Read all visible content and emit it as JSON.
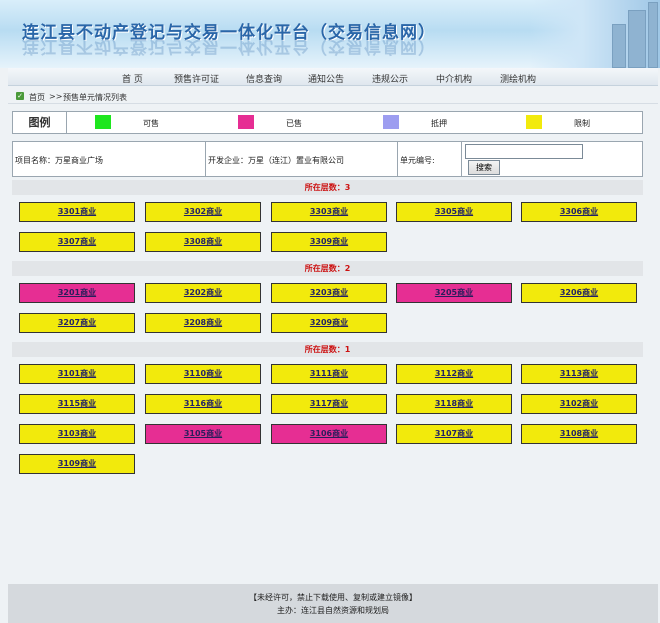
{
  "banner": {
    "title": "连江县不动产登记与交易一体化平台（交易信息网）"
  },
  "nav": [
    "首 页",
    "预售许可证",
    "信息查询",
    "通知公告",
    "违规公示",
    "中介机构",
    "测绘机构"
  ],
  "breadcrumb": {
    "home": "首页",
    "sep": ">>",
    "current": "预售单元情况列表"
  },
  "legend": {
    "label": "图例",
    "items": [
      {
        "name": "可售",
        "color": "#1ee61e"
      },
      {
        "name": "已售",
        "color": "#e62e93"
      },
      {
        "name": "抵押",
        "color": "#9d9df0"
      },
      {
        "name": "限制",
        "color": "#f2ea0c"
      }
    ]
  },
  "info": {
    "project": "项目名称：万星商业广场",
    "developer": "开发企业：万星（连江）置业有限公司",
    "unit_no_label": "单元编号:",
    "search_value": "",
    "search_button": "搜索"
  },
  "floors": [
    {
      "title": "所在层数：3",
      "units": [
        {
          "label": "3301商业",
          "status": "yellow"
        },
        {
          "label": "3302商业",
          "status": "yellow"
        },
        {
          "label": "3303商业",
          "status": "yellow"
        },
        {
          "label": "3305商业",
          "status": "yellow"
        },
        {
          "label": "3306商业",
          "status": "yellow"
        },
        {
          "label": "3307商业",
          "status": "yellow"
        },
        {
          "label": "3308商业",
          "status": "yellow"
        },
        {
          "label": "3309商业",
          "status": "yellow"
        }
      ]
    },
    {
      "title": "所在层数：2",
      "units": [
        {
          "label": "3201商业",
          "status": "pink"
        },
        {
          "label": "3202商业",
          "status": "yellow"
        },
        {
          "label": "3203商业",
          "status": "yellow"
        },
        {
          "label": "3205商业",
          "status": "pink"
        },
        {
          "label": "3206商业",
          "status": "yellow"
        },
        {
          "label": "3207商业",
          "status": "yellow"
        },
        {
          "label": "3208商业",
          "status": "yellow"
        },
        {
          "label": "3209商业",
          "status": "yellow"
        }
      ]
    },
    {
      "title": "所在层数：1",
      "units": [
        {
          "label": "3101商业",
          "status": "yellow"
        },
        {
          "label": "3110商业",
          "status": "yellow"
        },
        {
          "label": "3111商业",
          "status": "yellow"
        },
        {
          "label": "3112商业",
          "status": "yellow"
        },
        {
          "label": "3113商业",
          "status": "yellow"
        },
        {
          "label": "3115商业",
          "status": "yellow"
        },
        {
          "label": "3116商业",
          "status": "yellow"
        },
        {
          "label": "3117商业",
          "status": "yellow"
        },
        {
          "label": "3118商业",
          "status": "yellow"
        },
        {
          "label": "3102商业",
          "status": "yellow"
        },
        {
          "label": "3103商业",
          "status": "yellow"
        },
        {
          "label": "3105商业",
          "status": "pink"
        },
        {
          "label": "3106商业",
          "status": "pink"
        },
        {
          "label": "3107商业",
          "status": "yellow"
        },
        {
          "label": "3108商业",
          "status": "yellow"
        },
        {
          "label": "3109商业",
          "status": "yellow"
        }
      ]
    }
  ],
  "footer": {
    "line1": "【未经许可，禁止下载使用、复制或建立镜像】",
    "line2": "主办：连江县自然资源和规划局"
  }
}
